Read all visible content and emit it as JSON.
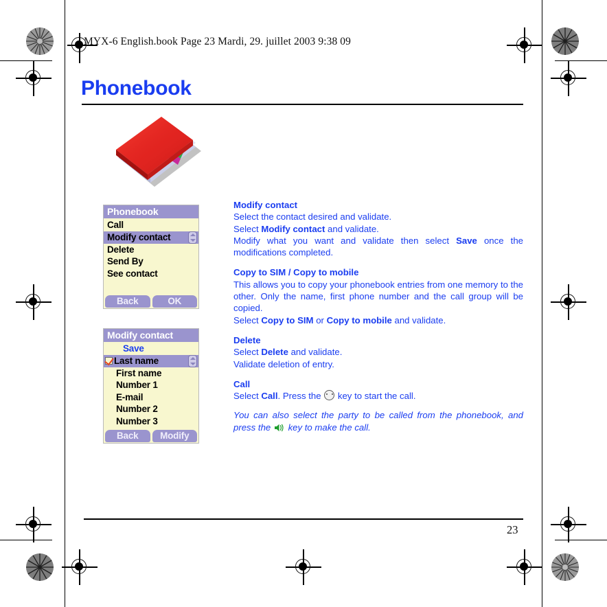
{
  "document": {
    "header_line": "MYX-6 English.book  Page 23  Mardi, 29. juillet 2003  9:38 09",
    "chapter_title": "Phonebook",
    "page_number": "23",
    "illustration_name": "red-address-book"
  },
  "screens": [
    {
      "id": "phonebook-menu",
      "title": "Phonebook",
      "items": [
        {
          "label": "Call",
          "state": "normal"
        },
        {
          "label": "Modify contact",
          "state": "highlighted"
        },
        {
          "label": "Delete",
          "state": "normal"
        },
        {
          "label": "Send By",
          "state": "normal"
        },
        {
          "label": "See contact",
          "state": "normal"
        }
      ],
      "softkeys": {
        "left": "Back",
        "right": "OK"
      }
    },
    {
      "id": "modify-contact-menu",
      "title": "Modify contact",
      "items": [
        {
          "label": "Save",
          "state": "save"
        },
        {
          "label": "Last name",
          "state": "highlighted",
          "checked": true
        },
        {
          "label": "First name",
          "state": "indent"
        },
        {
          "label": "Number 1",
          "state": "indent"
        },
        {
          "label": "E-mail",
          "state": "indent"
        },
        {
          "label": "Number 2",
          "state": "indent"
        },
        {
          "label": "Number 3",
          "state": "indent"
        }
      ],
      "softkeys": {
        "left": "Back",
        "right": "Modify"
      }
    }
  ],
  "sections": {
    "modify_contact": {
      "heading": "Modify contact",
      "line1": "Select the contact desired and validate.",
      "line2_pre": "Select ",
      "line2_bold": "Modify contact",
      "line2_post": " and validate.",
      "line3_pre": "Modify what you want and validate then select ",
      "line3_bold": "Save",
      "line3_post": " once the modifications completed."
    },
    "copy": {
      "heading": "Copy to SIM / Copy to mobile",
      "line1": "This allows you to copy your phonebook entries from one memory to the other. Only the name, first phone number and the call group will be copied.",
      "line2_pre": "Select ",
      "line2_bold_a": "Copy to SIM",
      "line2_mid": " or ",
      "line2_bold_b": "Copy to mobile",
      "line2_post": " and validate."
    },
    "delete": {
      "heading": "Delete",
      "line1_pre": "Select ",
      "line1_bold": "Delete",
      "line1_post": " and validate.",
      "line2": "Validate deletion of entry."
    },
    "call": {
      "heading": "Call",
      "line1_pre": "Select ",
      "line1_bold": "Call",
      "line1_mid": ". Press the ",
      "line1_post": " key to start the call.",
      "note_pre": "You can also select the party to be called from the phonebook, and press the ",
      "note_post": " key to make the call."
    }
  },
  "colors": {
    "link_blue": "#1a3df0",
    "screen_bg": "#f8f7cf",
    "screen_accent": "#9a94ce",
    "check_red": "#e8491f",
    "speaker_green": "#1f9e2e"
  }
}
